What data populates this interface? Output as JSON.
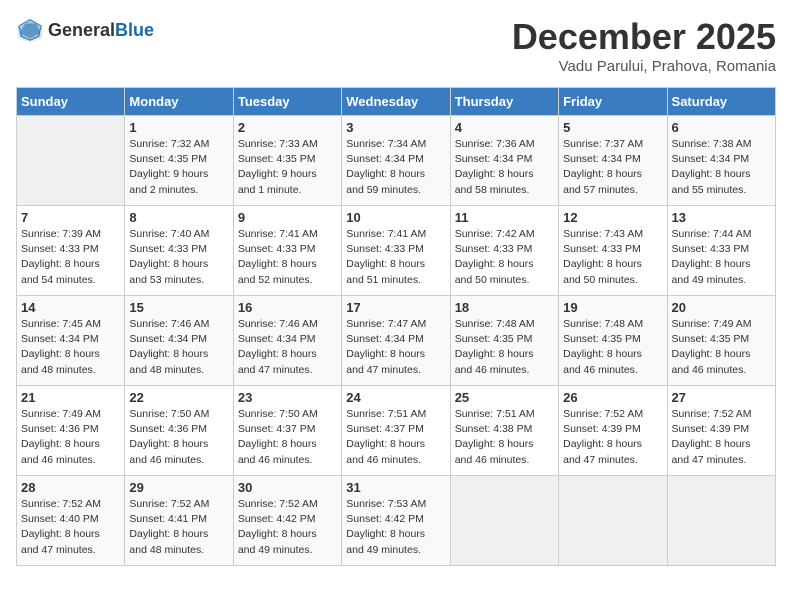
{
  "logo": {
    "general": "General",
    "blue": "Blue"
  },
  "title": "December 2025",
  "subtitle": "Vadu Parului, Prahova, Romania",
  "days_header": [
    "Sunday",
    "Monday",
    "Tuesday",
    "Wednesday",
    "Thursday",
    "Friday",
    "Saturday"
  ],
  "weeks": [
    [
      {
        "day": "",
        "text": ""
      },
      {
        "day": "1",
        "text": "Sunrise: 7:32 AM\nSunset: 4:35 PM\nDaylight: 9 hours\nand 2 minutes."
      },
      {
        "day": "2",
        "text": "Sunrise: 7:33 AM\nSunset: 4:35 PM\nDaylight: 9 hours\nand 1 minute."
      },
      {
        "day": "3",
        "text": "Sunrise: 7:34 AM\nSunset: 4:34 PM\nDaylight: 8 hours\nand 59 minutes."
      },
      {
        "day": "4",
        "text": "Sunrise: 7:36 AM\nSunset: 4:34 PM\nDaylight: 8 hours\nand 58 minutes."
      },
      {
        "day": "5",
        "text": "Sunrise: 7:37 AM\nSunset: 4:34 PM\nDaylight: 8 hours\nand 57 minutes."
      },
      {
        "day": "6",
        "text": "Sunrise: 7:38 AM\nSunset: 4:34 PM\nDaylight: 8 hours\nand 55 minutes."
      }
    ],
    [
      {
        "day": "7",
        "text": "Sunrise: 7:39 AM\nSunset: 4:33 PM\nDaylight: 8 hours\nand 54 minutes."
      },
      {
        "day": "8",
        "text": "Sunrise: 7:40 AM\nSunset: 4:33 PM\nDaylight: 8 hours\nand 53 minutes."
      },
      {
        "day": "9",
        "text": "Sunrise: 7:41 AM\nSunset: 4:33 PM\nDaylight: 8 hours\nand 52 minutes."
      },
      {
        "day": "10",
        "text": "Sunrise: 7:41 AM\nSunset: 4:33 PM\nDaylight: 8 hours\nand 51 minutes."
      },
      {
        "day": "11",
        "text": "Sunrise: 7:42 AM\nSunset: 4:33 PM\nDaylight: 8 hours\nand 50 minutes."
      },
      {
        "day": "12",
        "text": "Sunrise: 7:43 AM\nSunset: 4:33 PM\nDaylight: 8 hours\nand 50 minutes."
      },
      {
        "day": "13",
        "text": "Sunrise: 7:44 AM\nSunset: 4:33 PM\nDaylight: 8 hours\nand 49 minutes."
      }
    ],
    [
      {
        "day": "14",
        "text": "Sunrise: 7:45 AM\nSunset: 4:34 PM\nDaylight: 8 hours\nand 48 minutes."
      },
      {
        "day": "15",
        "text": "Sunrise: 7:46 AM\nSunset: 4:34 PM\nDaylight: 8 hours\nand 48 minutes."
      },
      {
        "day": "16",
        "text": "Sunrise: 7:46 AM\nSunset: 4:34 PM\nDaylight: 8 hours\nand 47 minutes."
      },
      {
        "day": "17",
        "text": "Sunrise: 7:47 AM\nSunset: 4:34 PM\nDaylight: 8 hours\nand 47 minutes."
      },
      {
        "day": "18",
        "text": "Sunrise: 7:48 AM\nSunset: 4:35 PM\nDaylight: 8 hours\nand 46 minutes."
      },
      {
        "day": "19",
        "text": "Sunrise: 7:48 AM\nSunset: 4:35 PM\nDaylight: 8 hours\nand 46 minutes."
      },
      {
        "day": "20",
        "text": "Sunrise: 7:49 AM\nSunset: 4:35 PM\nDaylight: 8 hours\nand 46 minutes."
      }
    ],
    [
      {
        "day": "21",
        "text": "Sunrise: 7:49 AM\nSunset: 4:36 PM\nDaylight: 8 hours\nand 46 minutes."
      },
      {
        "day": "22",
        "text": "Sunrise: 7:50 AM\nSunset: 4:36 PM\nDaylight: 8 hours\nand 46 minutes."
      },
      {
        "day": "23",
        "text": "Sunrise: 7:50 AM\nSunset: 4:37 PM\nDaylight: 8 hours\nand 46 minutes."
      },
      {
        "day": "24",
        "text": "Sunrise: 7:51 AM\nSunset: 4:37 PM\nDaylight: 8 hours\nand 46 minutes."
      },
      {
        "day": "25",
        "text": "Sunrise: 7:51 AM\nSunset: 4:38 PM\nDaylight: 8 hours\nand 46 minutes."
      },
      {
        "day": "26",
        "text": "Sunrise: 7:52 AM\nSunset: 4:39 PM\nDaylight: 8 hours\nand 47 minutes."
      },
      {
        "day": "27",
        "text": "Sunrise: 7:52 AM\nSunset: 4:39 PM\nDaylight: 8 hours\nand 47 minutes."
      }
    ],
    [
      {
        "day": "28",
        "text": "Sunrise: 7:52 AM\nSunset: 4:40 PM\nDaylight: 8 hours\nand 47 minutes."
      },
      {
        "day": "29",
        "text": "Sunrise: 7:52 AM\nSunset: 4:41 PM\nDaylight: 8 hours\nand 48 minutes."
      },
      {
        "day": "30",
        "text": "Sunrise: 7:52 AM\nSunset: 4:42 PM\nDaylight: 8 hours\nand 49 minutes."
      },
      {
        "day": "31",
        "text": "Sunrise: 7:53 AM\nSunset: 4:42 PM\nDaylight: 8 hours\nand 49 minutes."
      },
      {
        "day": "",
        "text": ""
      },
      {
        "day": "",
        "text": ""
      },
      {
        "day": "",
        "text": ""
      }
    ]
  ]
}
